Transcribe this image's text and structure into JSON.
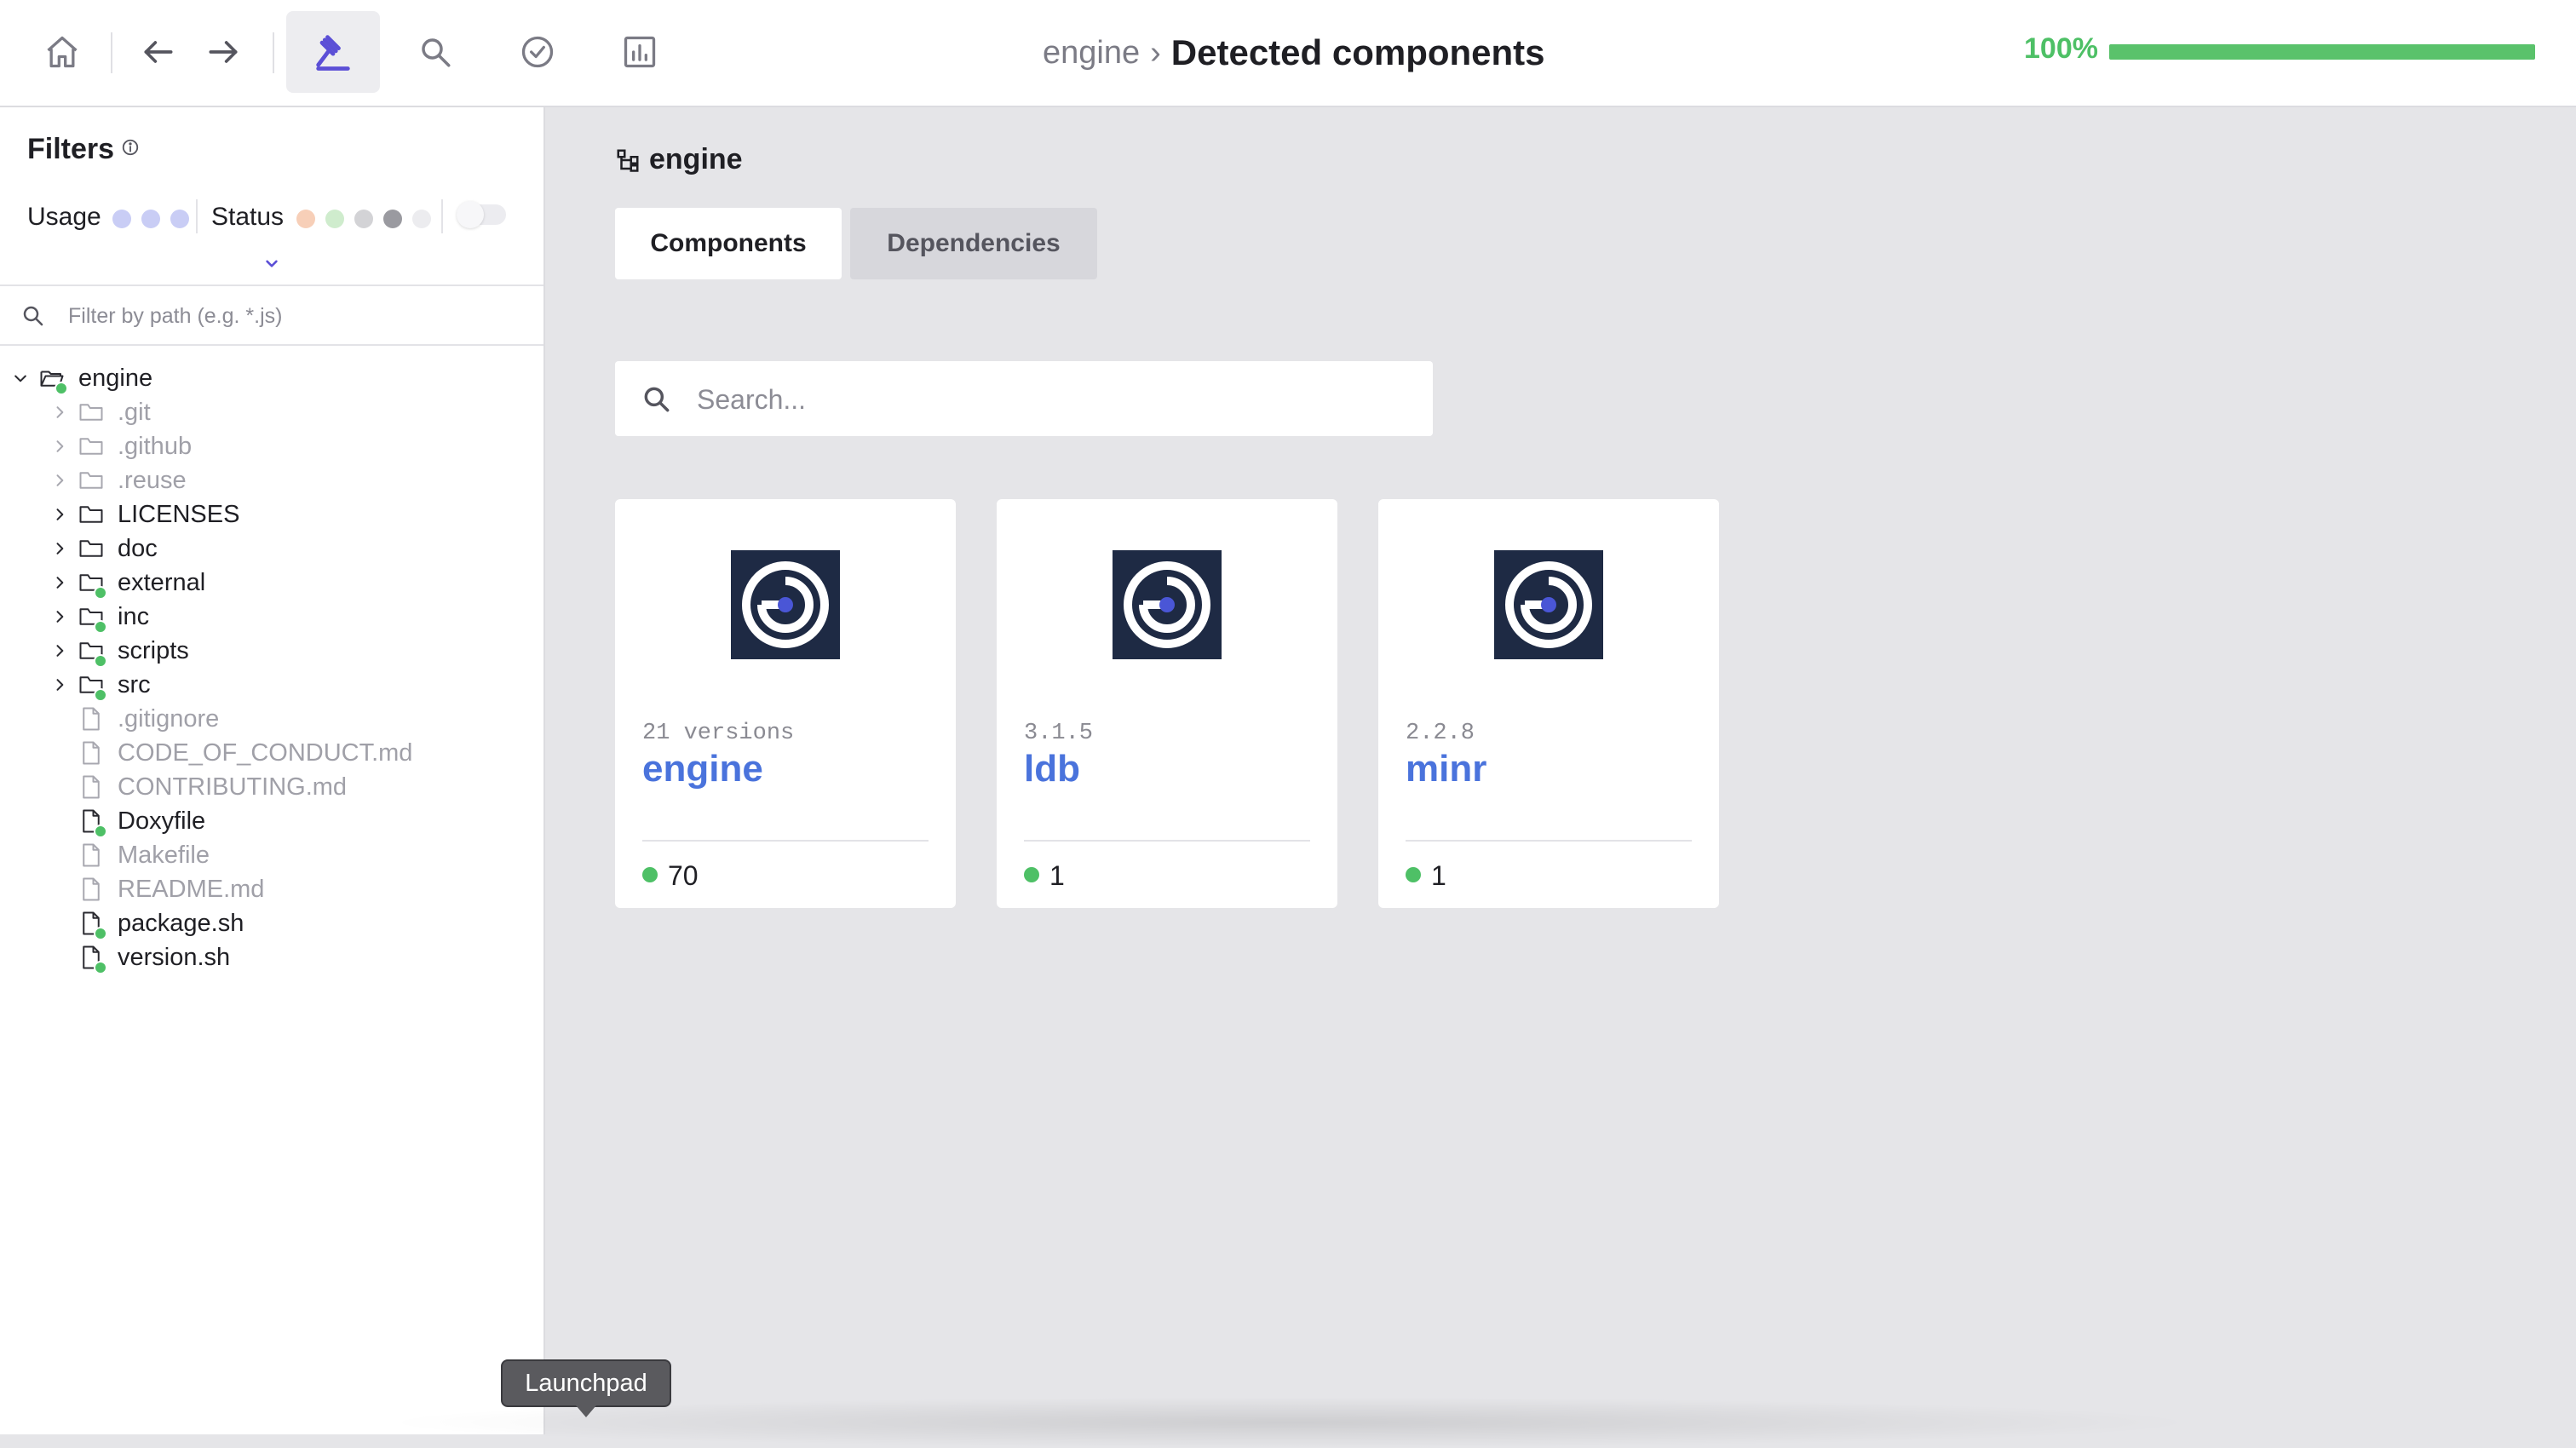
{
  "toolbar": {
    "buttons": [
      {
        "icon": "home-icon"
      },
      {
        "icon": "arrow-left-icon"
      },
      {
        "icon": "arrow-right-icon"
      },
      {
        "icon": "gavel-icon",
        "active": true
      },
      {
        "icon": "search-icon"
      },
      {
        "icon": "check-circle-icon"
      },
      {
        "icon": "chart-icon"
      }
    ]
  },
  "breadcrumb": {
    "root": "engine",
    "separator": "›",
    "current": "Detected components"
  },
  "progress": {
    "label": "100%",
    "value": 1.0
  },
  "sidebar": {
    "filters_title": "Filters",
    "usage_label": "Usage",
    "usage_dot_colors": [
      "#c9cdf5",
      "#c9cdf5",
      "#c9cdf5"
    ],
    "status_label": "Status",
    "status_dot_colors": [
      "#f7cfb8",
      "#cfeccd",
      "#d3d3d6",
      "#9a9aa0",
      "#ececef"
    ],
    "path_filter_placeholder": "Filter by path (e.g. *.js)",
    "tree": [
      {
        "name": "engine",
        "type": "folder-open",
        "depth": 0,
        "expanded": true,
        "muted": false,
        "status": "green"
      },
      {
        "name": ".git",
        "type": "folder",
        "depth": 1,
        "muted": true,
        "status": null
      },
      {
        "name": ".github",
        "type": "folder",
        "depth": 1,
        "muted": true,
        "status": null
      },
      {
        "name": ".reuse",
        "type": "folder",
        "depth": 1,
        "muted": true,
        "status": null
      },
      {
        "name": "LICENSES",
        "type": "folder",
        "depth": 1,
        "muted": false,
        "status": null
      },
      {
        "name": "doc",
        "type": "folder",
        "depth": 1,
        "muted": false,
        "status": null
      },
      {
        "name": "external",
        "type": "folder",
        "depth": 1,
        "muted": false,
        "status": "green"
      },
      {
        "name": "inc",
        "type": "folder",
        "depth": 1,
        "muted": false,
        "status": "green"
      },
      {
        "name": "scripts",
        "type": "folder",
        "depth": 1,
        "muted": false,
        "status": "green"
      },
      {
        "name": "src",
        "type": "folder",
        "depth": 1,
        "muted": false,
        "status": "green"
      },
      {
        "name": ".gitignore",
        "type": "file",
        "depth": 1,
        "muted": true,
        "status": null
      },
      {
        "name": "CODE_OF_CONDUCT.md",
        "type": "file",
        "depth": 1,
        "muted": true,
        "status": null
      },
      {
        "name": "CONTRIBUTING.md",
        "type": "file",
        "depth": 1,
        "muted": true,
        "status": null
      },
      {
        "name": "Doxyfile",
        "type": "file",
        "depth": 1,
        "muted": false,
        "status": "green"
      },
      {
        "name": "Makefile",
        "type": "file",
        "depth": 1,
        "muted": true,
        "status": null
      },
      {
        "name": "README.md",
        "type": "file",
        "depth": 1,
        "muted": true,
        "status": null
      },
      {
        "name": "package.sh",
        "type": "file",
        "depth": 1,
        "muted": false,
        "status": "green"
      },
      {
        "name": "version.sh",
        "type": "file",
        "depth": 1,
        "muted": false,
        "status": "green"
      }
    ]
  },
  "main": {
    "title": "engine",
    "tabs": [
      {
        "label": "Components",
        "active": true
      },
      {
        "label": "Dependencies",
        "active": false
      }
    ],
    "search_placeholder": "Search...",
    "cards": [
      {
        "version": "21 versions",
        "name": "engine",
        "count": "70"
      },
      {
        "version": "3.1.5",
        "name": "ldb",
        "count": "1"
      },
      {
        "version": "2.2.8",
        "name": "minr",
        "count": "1"
      }
    ]
  },
  "tooltip": {
    "label": "Launchpad"
  },
  "colors": {
    "accent": "#4a73dc",
    "active_icon": "#5b4fd6",
    "status_green": "#4ec066",
    "logo_bg": "#1e2a44"
  }
}
